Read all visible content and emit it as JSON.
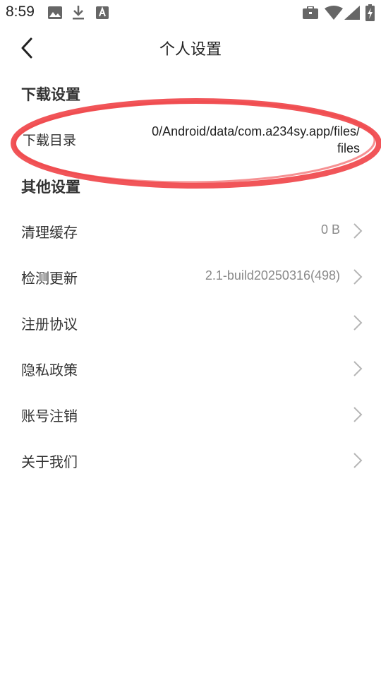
{
  "status_bar": {
    "time": "8:59",
    "left_icons": [
      "image-icon",
      "download-icon",
      "a-icon"
    ],
    "right_icons": [
      "briefcase-icon",
      "wifi-icon",
      "signal-icon",
      "battery-icon"
    ]
  },
  "header": {
    "back_icon": "chevron-left-icon",
    "title": "个人设置"
  },
  "download_section": {
    "title": "下载设置",
    "items": [
      {
        "label": "下载目录",
        "value_line1": "0/Android/data/com.a234sy.app/files/",
        "value_line2": "files"
      }
    ]
  },
  "other_section": {
    "title": "其他设置",
    "items": [
      {
        "label": "清理缓存",
        "value": "0 B"
      },
      {
        "label": "检测更新",
        "value": "2.1-build20250316(498)"
      },
      {
        "label": "注册协议",
        "value": ""
      },
      {
        "label": "隐私政策",
        "value": ""
      },
      {
        "label": "账号注销",
        "value": ""
      },
      {
        "label": "关于我们",
        "value": ""
      }
    ]
  },
  "colors": {
    "annotation_red": "#f0474b",
    "value_gray": "#8a8a8a",
    "chevron_gray": "#b5b5b5"
  }
}
